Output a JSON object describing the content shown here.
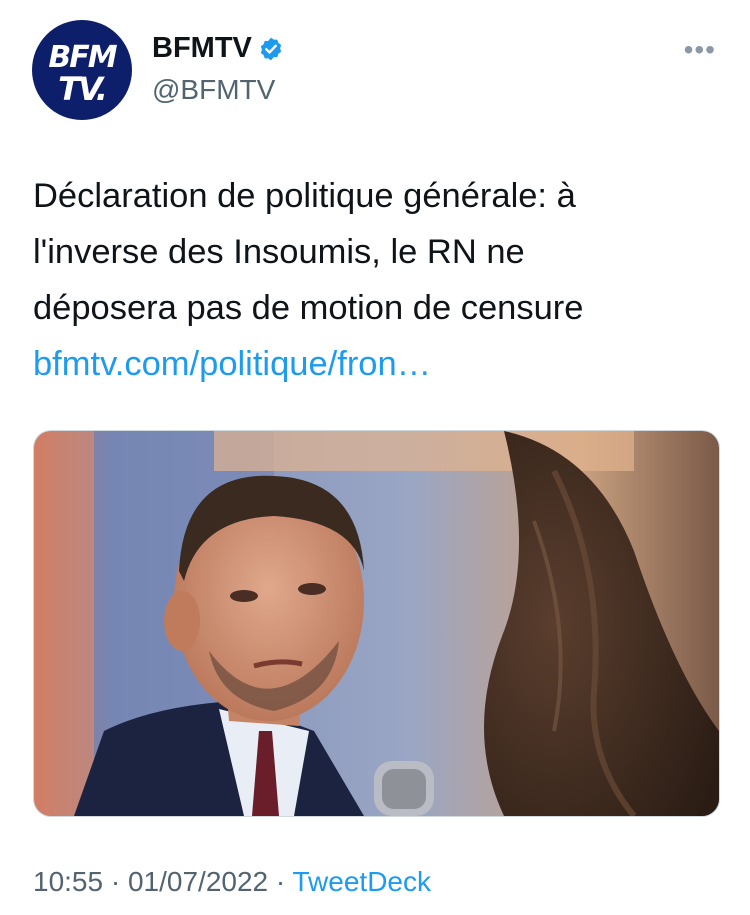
{
  "author": {
    "display_name": "BFMTV",
    "handle": "@BFMTV",
    "avatar_line1": "BFM",
    "avatar_line2": "TV.",
    "verified": true
  },
  "menu_icon": "more-horizontal-icon",
  "tweet": {
    "text": "Déclaration de politique générale: à\nl'inverse des Insoumis, le RN ne\ndéposera pas de motion de censure",
    "link": "bfmtv.com/politique/fron…"
  },
  "meta": {
    "time": "10:55",
    "separator1": " · ",
    "date": "01/07/2022",
    "separator2": " · ",
    "source": "TweetDeck"
  },
  "colors": {
    "link": "#1d9bf0",
    "secondary_text": "#536471",
    "avatar_bg": "#0d1f6b"
  }
}
